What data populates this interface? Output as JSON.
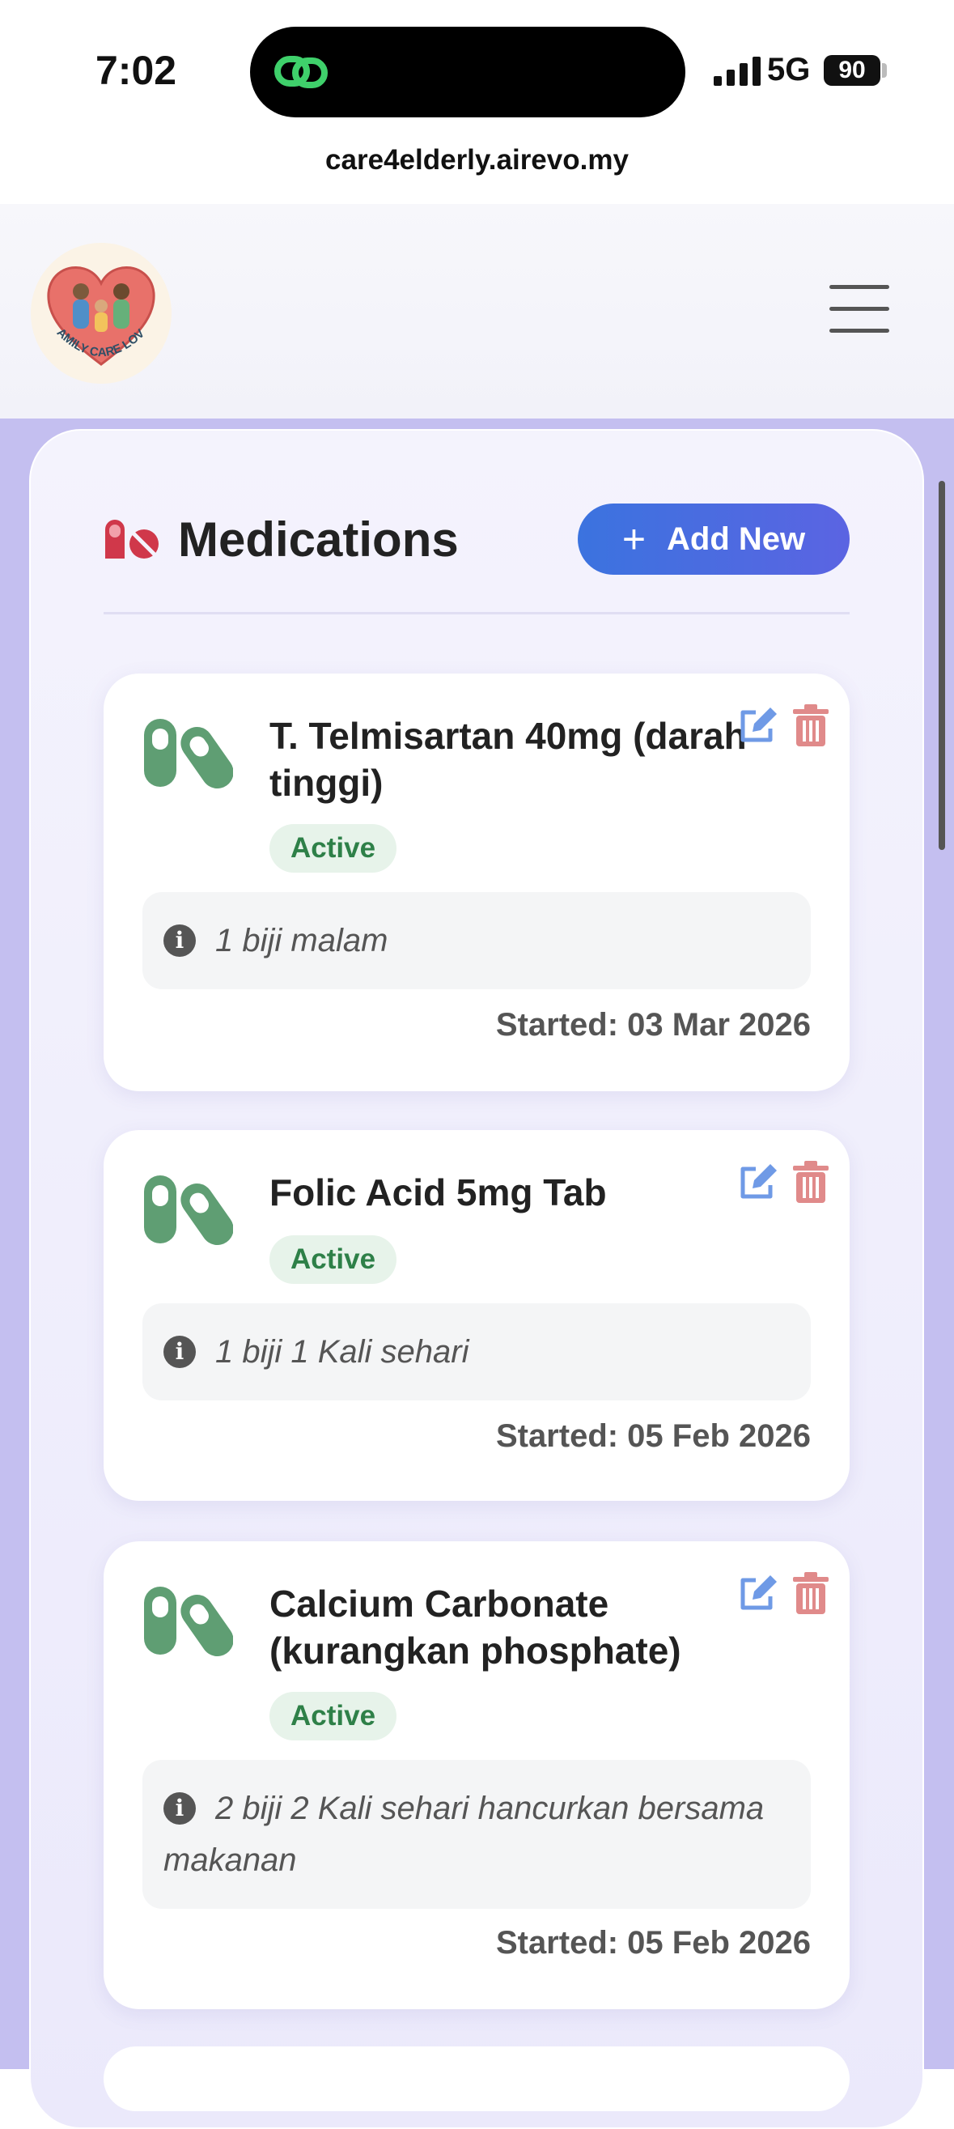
{
  "status_bar": {
    "time": "7:02",
    "network": "5G",
    "battery": "90"
  },
  "browser": {
    "url": "care4elderly.airevo.my"
  },
  "header": {
    "logo_text": "FAMILY CARE LOVE"
  },
  "page": {
    "title": "Medications",
    "add_button_label": "Add New"
  },
  "medications": [
    {
      "name": "T. Telmisartan 40mg (darah tinggi)",
      "status": "Active",
      "note": "1 biji malam",
      "started": "Started: 03 Mar 2026"
    },
    {
      "name": "Folic Acid 5mg Tab",
      "status": "Active",
      "note": "1 biji 1 Kali sehari",
      "started": "Started: 05 Feb 2026"
    },
    {
      "name": "Calcium Carbonate (kurangkan phosphate)",
      "status": "Active",
      "note": "2 biji 2 Kali sehari hancurkan bersama makanan",
      "started": "Started: 05 Feb 2026"
    }
  ],
  "colors": {
    "accent_blue": "#3b73df",
    "active_green": "#2e8048",
    "pill_green": "#5f9e73",
    "title_pill_red": "#d0384a",
    "edit_blue": "#6f9ae6",
    "delete_red": "#e08a8a"
  },
  "icons": {
    "island": "link-icon",
    "title": "pills-icon",
    "card": "pills-icon",
    "edit": "edit-icon",
    "delete": "trash-icon",
    "info": "info-icon",
    "menu": "hamburger-icon"
  }
}
